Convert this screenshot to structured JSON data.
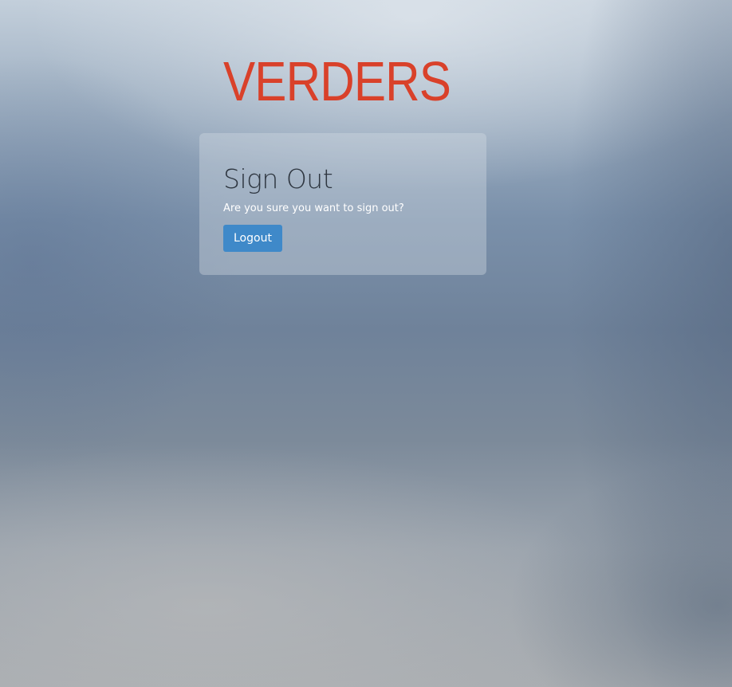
{
  "brand": {
    "logo_text": "VERDERS",
    "logo_color": "#d9412a"
  },
  "signout": {
    "title": "Sign Out",
    "message": "Are you sure you want to sign out?",
    "logout_label": "Logout",
    "button_color": "#3f89c9"
  }
}
